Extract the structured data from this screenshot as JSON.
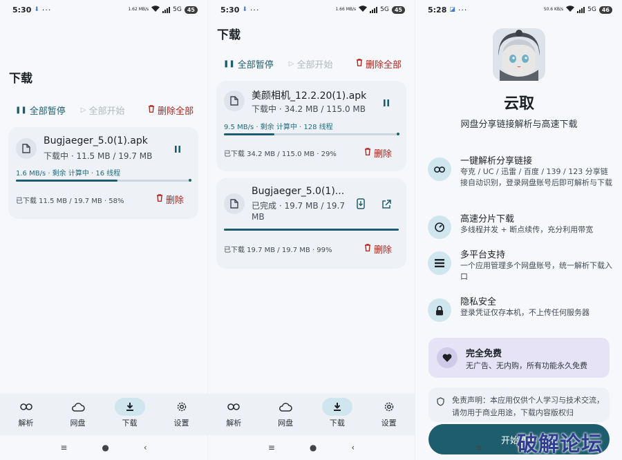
{
  "screens": [
    {
      "status": {
        "time": "5:30",
        "speed": "1.62 MB/s",
        "network": "5G",
        "battery": "45"
      },
      "title": "下载",
      "actions": {
        "pause_all": "全部暂停",
        "start_all": "全部开始",
        "delete_all": "删除全部"
      },
      "downloads": [
        {
          "name": "Bugjaeger_5.0(1).apk",
          "status": "下载中 · 11.5 MB / 19.7 MB",
          "meta": "1.6 MB/s · 剩余 计算中 · 16 线程",
          "progress": 0.58,
          "footer": "已下载 11.5 MB / 19.7 MB · 58%",
          "delete": "删除"
        }
      ]
    },
    {
      "status": {
        "time": "5:30",
        "speed": "1.66 MB/s",
        "network": "5G",
        "battery": "45"
      },
      "title": "下载",
      "actions": {
        "pause_all": "全部暂停",
        "start_all": "全部开始",
        "delete_all": "删除全部"
      },
      "downloads": [
        {
          "name": "美颜相机_12.2.20(1).apk",
          "status": "下载中 · 34.2 MB / 115.0 MB",
          "meta": "9.5 MB/s · 剩余 计算中 · 128 线程",
          "progress": 0.29,
          "footer": "已下载 34.2 MB / 115.0 MB · 29%",
          "delete": "删除"
        },
        {
          "name": "Bugjaeger_5.0(1)...",
          "status": "已完成 · 19.7 MB / 19.7 MB",
          "progress": 1.0,
          "footer": "已下载 19.7 MB / 19.7 MB · 99%",
          "delete": "删除"
        }
      ]
    },
    {
      "status": {
        "time": "5:28",
        "speed": "50.6 KB/s",
        "network": "5G",
        "battery": "46"
      },
      "app_name": "云取",
      "app_subtitle": "网盘分享链接解析与高速下载",
      "features": [
        {
          "icon": "link-icon",
          "title": "一键解析分享链接",
          "desc": "夸克 / UC / 迅雷 / 百度 / 139 / 123 分享链接自动识别，登录网盘账号后即可解析与下载"
        },
        {
          "icon": "speedometer-icon",
          "title": "高速分片下载",
          "desc": "多线程并发 + 断点续传，充分利用带宽"
        },
        {
          "icon": "list-icon",
          "title": "多平台支持",
          "desc": "一个应用管理多个网盘账号，统一解析下载入口"
        },
        {
          "icon": "lock-icon",
          "title": "隐私安全",
          "desc": "登录凭证仅存本机，不上传任何服务器"
        }
      ],
      "free": {
        "title": "完全免费",
        "desc": "无广告、无内购，所有功能永久免费"
      },
      "disclaimer": "免责声明：本应用仅供个人学习与技术交流，请勿用于商业用途，下载内容版权归",
      "start_button": "开始使用",
      "watermark": "破解论坛"
    }
  ],
  "nav": [
    {
      "label": "解析",
      "icon": "link-icon"
    },
    {
      "label": "网盘",
      "icon": "cloud-icon"
    },
    {
      "label": "下载",
      "icon": "download-icon"
    },
    {
      "label": "设置",
      "icon": "gear-icon"
    }
  ],
  "colors": {
    "accent": "#1e5d6e",
    "danger": "#b3261e",
    "nav_active": "#cfe6ee",
    "free_card": "#e6e3f6"
  }
}
